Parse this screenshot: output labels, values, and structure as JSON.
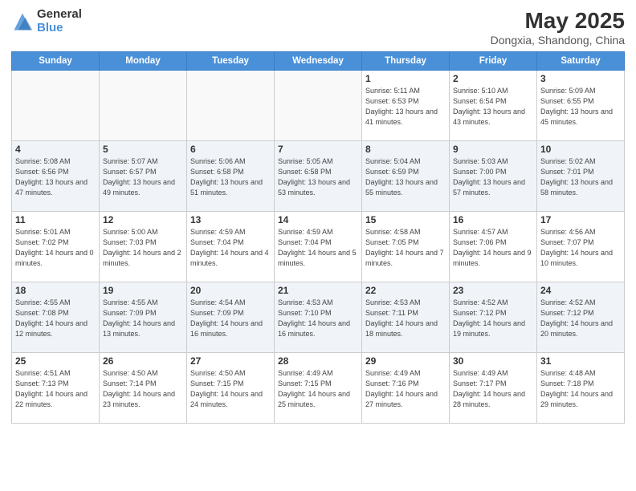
{
  "header": {
    "logo_general": "General",
    "logo_blue": "Blue",
    "main_title": "May 2025",
    "subtitle": "Dongxia, Shandong, China"
  },
  "days_of_week": [
    "Sunday",
    "Monday",
    "Tuesday",
    "Wednesday",
    "Thursday",
    "Friday",
    "Saturday"
  ],
  "weeks": [
    [
      {
        "day": "",
        "info": ""
      },
      {
        "day": "",
        "info": ""
      },
      {
        "day": "",
        "info": ""
      },
      {
        "day": "",
        "info": ""
      },
      {
        "day": "1",
        "info": "Sunrise: 5:11 AM\nSunset: 6:53 PM\nDaylight: 13 hours and 41 minutes."
      },
      {
        "day": "2",
        "info": "Sunrise: 5:10 AM\nSunset: 6:54 PM\nDaylight: 13 hours and 43 minutes."
      },
      {
        "day": "3",
        "info": "Sunrise: 5:09 AM\nSunset: 6:55 PM\nDaylight: 13 hours and 45 minutes."
      }
    ],
    [
      {
        "day": "4",
        "info": "Sunrise: 5:08 AM\nSunset: 6:56 PM\nDaylight: 13 hours and 47 minutes."
      },
      {
        "day": "5",
        "info": "Sunrise: 5:07 AM\nSunset: 6:57 PM\nDaylight: 13 hours and 49 minutes."
      },
      {
        "day": "6",
        "info": "Sunrise: 5:06 AM\nSunset: 6:58 PM\nDaylight: 13 hours and 51 minutes."
      },
      {
        "day": "7",
        "info": "Sunrise: 5:05 AM\nSunset: 6:58 PM\nDaylight: 13 hours and 53 minutes."
      },
      {
        "day": "8",
        "info": "Sunrise: 5:04 AM\nSunset: 6:59 PM\nDaylight: 13 hours and 55 minutes."
      },
      {
        "day": "9",
        "info": "Sunrise: 5:03 AM\nSunset: 7:00 PM\nDaylight: 13 hours and 57 minutes."
      },
      {
        "day": "10",
        "info": "Sunrise: 5:02 AM\nSunset: 7:01 PM\nDaylight: 13 hours and 58 minutes."
      }
    ],
    [
      {
        "day": "11",
        "info": "Sunrise: 5:01 AM\nSunset: 7:02 PM\nDaylight: 14 hours and 0 minutes."
      },
      {
        "day": "12",
        "info": "Sunrise: 5:00 AM\nSunset: 7:03 PM\nDaylight: 14 hours and 2 minutes."
      },
      {
        "day": "13",
        "info": "Sunrise: 4:59 AM\nSunset: 7:04 PM\nDaylight: 14 hours and 4 minutes."
      },
      {
        "day": "14",
        "info": "Sunrise: 4:59 AM\nSunset: 7:04 PM\nDaylight: 14 hours and 5 minutes."
      },
      {
        "day": "15",
        "info": "Sunrise: 4:58 AM\nSunset: 7:05 PM\nDaylight: 14 hours and 7 minutes."
      },
      {
        "day": "16",
        "info": "Sunrise: 4:57 AM\nSunset: 7:06 PM\nDaylight: 14 hours and 9 minutes."
      },
      {
        "day": "17",
        "info": "Sunrise: 4:56 AM\nSunset: 7:07 PM\nDaylight: 14 hours and 10 minutes."
      }
    ],
    [
      {
        "day": "18",
        "info": "Sunrise: 4:55 AM\nSunset: 7:08 PM\nDaylight: 14 hours and 12 minutes."
      },
      {
        "day": "19",
        "info": "Sunrise: 4:55 AM\nSunset: 7:09 PM\nDaylight: 14 hours and 13 minutes."
      },
      {
        "day": "20",
        "info": "Sunrise: 4:54 AM\nSunset: 7:09 PM\nDaylight: 14 hours and 16 minutes."
      },
      {
        "day": "21",
        "info": "Sunrise: 4:53 AM\nSunset: 7:10 PM\nDaylight: 14 hours and 16 minutes."
      },
      {
        "day": "22",
        "info": "Sunrise: 4:53 AM\nSunset: 7:11 PM\nDaylight: 14 hours and 18 minutes."
      },
      {
        "day": "23",
        "info": "Sunrise: 4:52 AM\nSunset: 7:12 PM\nDaylight: 14 hours and 19 minutes."
      },
      {
        "day": "24",
        "info": "Sunrise: 4:52 AM\nSunset: 7:12 PM\nDaylight: 14 hours and 20 minutes."
      }
    ],
    [
      {
        "day": "25",
        "info": "Sunrise: 4:51 AM\nSunset: 7:13 PM\nDaylight: 14 hours and 22 minutes."
      },
      {
        "day": "26",
        "info": "Sunrise: 4:50 AM\nSunset: 7:14 PM\nDaylight: 14 hours and 23 minutes."
      },
      {
        "day": "27",
        "info": "Sunrise: 4:50 AM\nSunset: 7:15 PM\nDaylight: 14 hours and 24 minutes."
      },
      {
        "day": "28",
        "info": "Sunrise: 4:49 AM\nSunset: 7:15 PM\nDaylight: 14 hours and 25 minutes."
      },
      {
        "day": "29",
        "info": "Sunrise: 4:49 AM\nSunset: 7:16 PM\nDaylight: 14 hours and 27 minutes."
      },
      {
        "day": "30",
        "info": "Sunrise: 4:49 AM\nSunset: 7:17 PM\nDaylight: 14 hours and 28 minutes."
      },
      {
        "day": "31",
        "info": "Sunrise: 4:48 AM\nSunset: 7:18 PM\nDaylight: 14 hours and 29 minutes."
      }
    ]
  ],
  "alt_rows": [
    1,
    3
  ]
}
